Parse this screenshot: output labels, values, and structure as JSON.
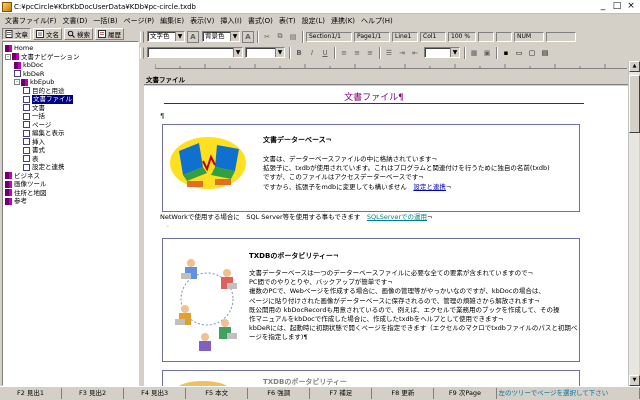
{
  "window": {
    "title": "C:¥pcCircle¥KbrKbDocUserData¥KDb¥pc-circle.txdb",
    "minimize": "_",
    "maximize": "□",
    "close": "×"
  },
  "menu": [
    "文書ファイル(F)",
    "文書(D)",
    "一括(B)",
    "ページ(P)",
    "編集(E)",
    "表示(V)",
    "挿入(I)",
    "書式(O)",
    "表(T)",
    "設定(L)",
    "連携(K)",
    "ヘルプ(H)"
  ],
  "left_tabs": [
    {
      "label": "文章"
    },
    {
      "label": "文名"
    },
    {
      "label": "検索"
    },
    {
      "label": "履歴"
    }
  ],
  "toolbar1": {
    "color_select": "文字色",
    "style_select": "背景色",
    "section": "Section1/1",
    "page": "Page1/1",
    "line": "Line1",
    "col": "Col1",
    "zoom": "100 %",
    "num": "NUM"
  },
  "tree": [
    {
      "label": "Home",
      "level": 0,
      "icon": "book"
    },
    {
      "label": "文書ナビゲーション",
      "level": 0,
      "icon": "book",
      "expand": "-"
    },
    {
      "label": "kbDoc",
      "level": 1,
      "icon": "book"
    },
    {
      "label": "kbDeR",
      "level": 1,
      "icon": "page"
    },
    {
      "label": "kbEpub",
      "level": 1,
      "icon": "book",
      "expand": "-"
    },
    {
      "label": "目的と用途",
      "level": 2,
      "icon": "page"
    },
    {
      "label": "文書ファイル",
      "level": 2,
      "icon": "page",
      "selected": true
    },
    {
      "label": "文書",
      "level": 2,
      "icon": "page"
    },
    {
      "label": "一括",
      "level": 2,
      "icon": "page"
    },
    {
      "label": "ページ",
      "level": 2,
      "icon": "page"
    },
    {
      "label": "編集と表示",
      "level": 2,
      "icon": "page"
    },
    {
      "label": "挿入",
      "level": 2,
      "icon": "page"
    },
    {
      "label": "書式",
      "level": 2,
      "icon": "page"
    },
    {
      "label": "表",
      "level": 2,
      "icon": "page"
    },
    {
      "label": "設定と連携",
      "level": 2,
      "icon": "page"
    },
    {
      "label": "ビジネス",
      "level": 0,
      "icon": "book"
    },
    {
      "label": "画像ツール",
      "level": 0,
      "icon": "book"
    },
    {
      "label": "住所と地図",
      "level": 0,
      "icon": "book"
    },
    {
      "label": "参考",
      "level": 0,
      "icon": "book"
    }
  ],
  "doc": {
    "header": "文書ファイル",
    "title": "文書ファイル¶",
    "pilcrow": "¶",
    "sec1": {
      "title": "文書データーベース¬",
      "lines": [
        "文書は、データーベースファイルの中に格納されています¬",
        "拡張子に、txdbが使用されています。これはプログラムと関連付けを行うために独自の名前(txdb)",
        "ですが、このファイルはアクセスデーターベースです¬",
        "ですから、拡張子をmdbに変更しても構いません"
      ],
      "link": "設定と連携",
      "after": "¬"
    },
    "network_line": "NetWorkで使用する場合に　SQL Server等を使用する事もできます",
    "network_link": "SQLServerでの運用",
    "sec2": {
      "title": "TXDBのポータビリティー¬",
      "lines": [
        "文書データーベースは一つのデーターベースファイルに必要な全ての要素が含まれていますので¬",
        "PC間でのやりとりや、バックアップが簡単です¬",
        "複数のPCで、Webページを作成する場合に、画像の管理等がやっかいなのですが、kbDocの場合は、",
        "ページに貼り付けされた画像がデーターベースに保存されるので、管理の煩雑さから解放されます¬",
        "既公開用の kbDocRecordも用意されているので、例えば、エクセルで業務用のブックを作成して、その操",
        "作マニュアルをkbDocで作成した場合に、作成したtxdbをヘルプとして使用できます¬",
        "kbDeRには、起動時に初期状態で開くページを指定できます（エクセルのマクロでtxdbファイルのパスと初期ペ",
        "ージを指定します)¶"
      ]
    },
    "sec3_title": "TXDBのポータビリティー"
  },
  "status": {
    "keys": [
      "F2 見出1",
      "F3 見出2",
      "F4 見出3",
      "F5 本文",
      "F6 強調",
      "F7 補足",
      "F8 更新",
      "F9 次Page"
    ],
    "tip": "左のツリーでページを選択して下さい"
  }
}
